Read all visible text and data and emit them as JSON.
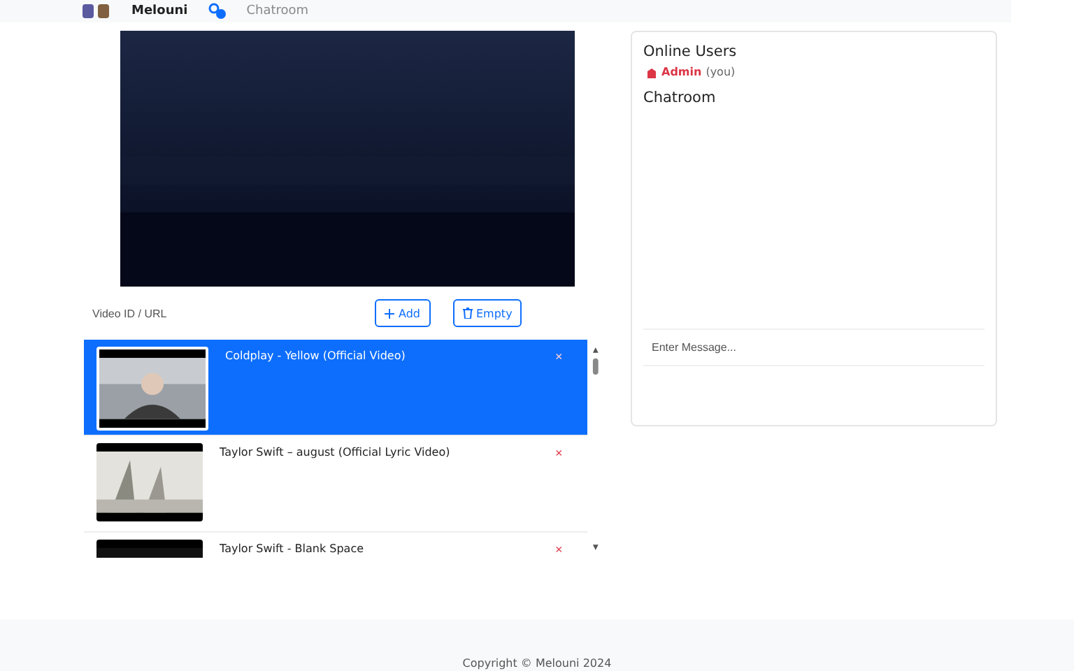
{
  "header": {
    "brand": "Melouni",
    "nav": [
      {
        "label": "Chatroom"
      }
    ]
  },
  "controls": {
    "input": {
      "placeholder": "Video ID / URL"
    },
    "buttons": [
      {
        "label": "Add",
        "kind": "add"
      },
      {
        "label": "Empty",
        "kind": "empty"
      }
    ]
  },
  "playlist": [
    {
      "title": "Coldplay - Yellow (Official Video)",
      "selected": true,
      "remove": "×"
    },
    {
      "title": "Taylor Swift – august (Official Lyric Video)",
      "selected": false,
      "remove": "×"
    },
    {
      "title": "Taylor Swift - Blank Space",
      "selected": false,
      "remove": "×"
    }
  ],
  "sidebar": {
    "online_title": "Online Users",
    "users": [
      {
        "name": "Admin",
        "note": "(you)"
      }
    ],
    "chat_title": "Chatroom",
    "message": {
      "placeholder": "Enter Message..."
    }
  },
  "footer": {
    "text": "Copyright © Melouni 2024"
  }
}
